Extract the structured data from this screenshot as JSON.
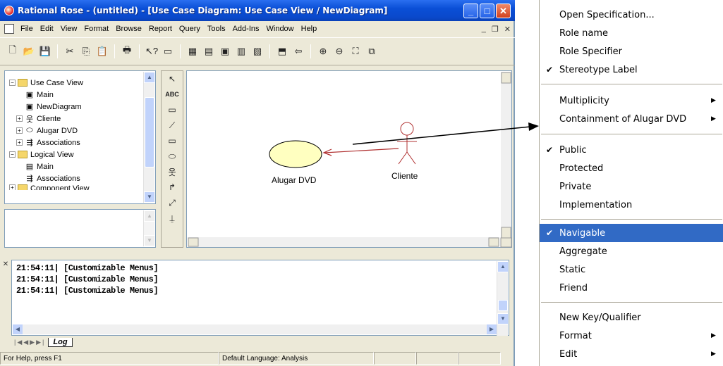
{
  "window": {
    "title": "Rational Rose - (untitled) - [Use Case Diagram: Use Case View / NewDiagram]"
  },
  "menubar": {
    "items": [
      "File",
      "Edit",
      "View",
      "Format",
      "Browse",
      "Report",
      "Query",
      "Tools",
      "Add-Ins",
      "Window",
      "Help"
    ]
  },
  "browser": {
    "nodes": [
      {
        "label": "Use Case View"
      },
      {
        "label": "Main"
      },
      {
        "label": "NewDiagram"
      },
      {
        "label": "Cliente"
      },
      {
        "label": "Alugar DVD"
      },
      {
        "label": "Associations"
      },
      {
        "label": "Logical View"
      },
      {
        "label": "Main"
      },
      {
        "label": "Associations"
      },
      {
        "label": "Component View"
      }
    ]
  },
  "palette": {
    "text_tool": "ABC"
  },
  "diagram": {
    "usecase_label": "Alugar DVD",
    "actor_label": "Cliente"
  },
  "log": {
    "lines": [
      "21:54:11|  [Customizable Menus]",
      "21:54:11|  [Customizable Menus]",
      "21:54:11|  [Customizable Menus]"
    ],
    "tab_label": "Log"
  },
  "statusbar": {
    "help": "For Help, press F1",
    "language": "Default Language: Analysis"
  },
  "context_menu": {
    "items": [
      {
        "label": "Open Specification...",
        "checked": false,
        "submenu": false
      },
      {
        "label": "Role name",
        "checked": false,
        "submenu": false
      },
      {
        "label": "Role Specifier",
        "checked": false,
        "submenu": false
      },
      {
        "label": "Stereotype Label",
        "checked": true,
        "submenu": false
      },
      {
        "label": "Multiplicity",
        "checked": false,
        "submenu": true
      },
      {
        "label": "Containment of Alugar DVD",
        "checked": false,
        "submenu": true
      },
      {
        "label": "Public",
        "checked": true,
        "submenu": false
      },
      {
        "label": "Protected",
        "checked": false,
        "submenu": false
      },
      {
        "label": "Private",
        "checked": false,
        "submenu": false
      },
      {
        "label": "Implementation",
        "checked": false,
        "submenu": false
      },
      {
        "label": "Navigable",
        "checked": true,
        "submenu": false,
        "highlighted": true
      },
      {
        "label": "Aggregate",
        "checked": false,
        "submenu": false
      },
      {
        "label": "Static",
        "checked": false,
        "submenu": false
      },
      {
        "label": "Friend",
        "checked": false,
        "submenu": false
      },
      {
        "label": "New Key/Qualifier",
        "checked": false,
        "submenu": false
      },
      {
        "label": "Format",
        "checked": false,
        "submenu": true
      },
      {
        "label": "Edit",
        "checked": false,
        "submenu": true
      }
    ],
    "highlight_color": "#316ac5"
  },
  "colors": {
    "titlebar": "#0a4fd6",
    "usecase_fill": "#ffffc0",
    "association_line": "#b03030"
  }
}
